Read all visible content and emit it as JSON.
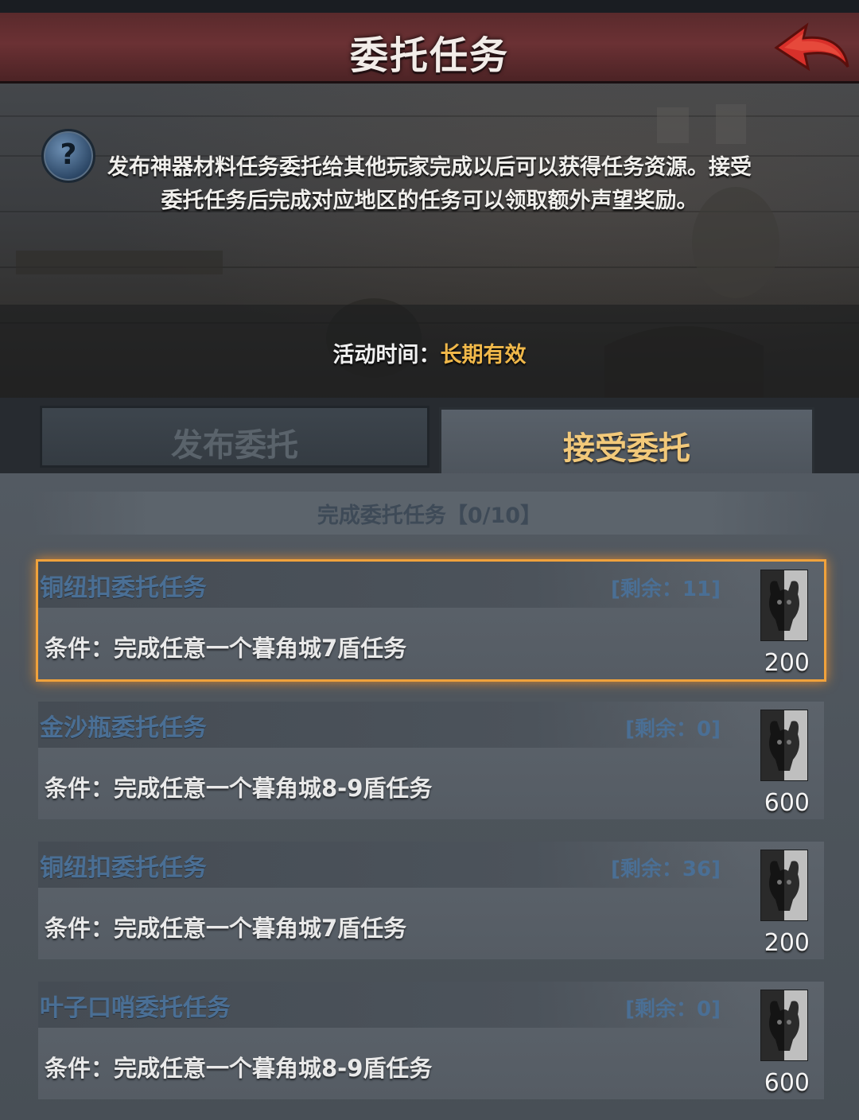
{
  "header": {
    "title": "委托任务"
  },
  "info": {
    "description_line1": "发布神器材料任务委托给其他玩家完成以后可以获得任务资源。接受",
    "description_line2": "委托任务后完成对应地区的任务可以领取额外声望奖励。",
    "time_label": "活动时间：",
    "time_value": "长期有效"
  },
  "tabs": [
    {
      "label": "发布委托",
      "active": false
    },
    {
      "label": "接受委托",
      "active": true
    }
  ],
  "progress": {
    "text": "完成委托任务【0/10】"
  },
  "tasks": [
    {
      "name": "铜纽扣委托任务",
      "remaining": "[剩余：11]",
      "condition": "条件：完成任意一个暮角城7盾任务",
      "reward": "200",
      "selected": true
    },
    {
      "name": "金沙瓶委托任务",
      "remaining": "[剩余：0]",
      "condition": "条件：完成任意一个暮角城8-9盾任务",
      "reward": "600",
      "selected": false
    },
    {
      "name": "铜纽扣委托任务",
      "remaining": "[剩余：36]",
      "condition": "条件：完成任意一个暮角城7盾任务",
      "reward": "200",
      "selected": false
    },
    {
      "name": "叶子口哨委托任务",
      "remaining": "[剩余：0]",
      "condition": "条件：完成任意一个暮角城8-9盾任务",
      "reward": "600",
      "selected": false
    }
  ],
  "colors": {
    "header": "#6b3134",
    "accent_gold": "#f0b84a",
    "selection_glow": "#f0a23c",
    "task_title": "#4a6f95"
  },
  "icons": {
    "back": "red-back-arrow-icon",
    "help": "question-mark-icon",
    "reward": "demon-card-icon"
  }
}
